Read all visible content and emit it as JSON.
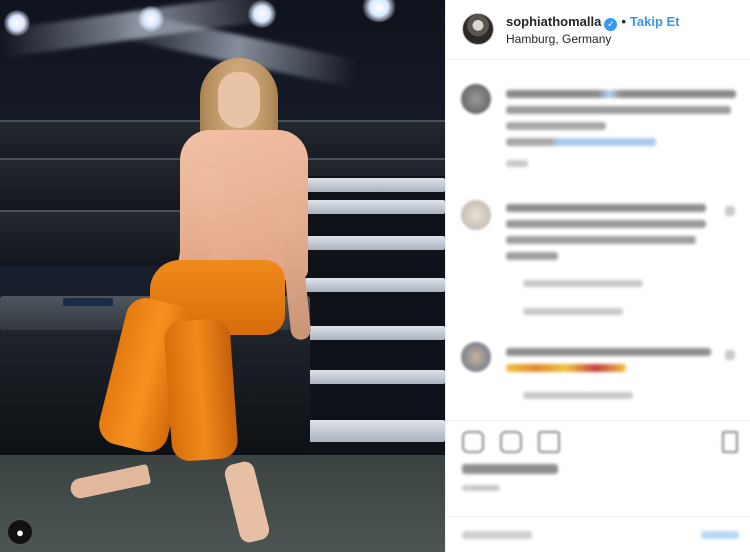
{
  "post": {
    "username": "sophiathomalla",
    "verified_icon": "verified-badge-icon",
    "separator": "•",
    "follow_label": "Takip Et",
    "location": "Hamburg, Germany"
  },
  "photo_overlay": {
    "profile_icon": "user-silhouette-icon"
  },
  "colors": {
    "accent": "#3897f0",
    "border": "#efefef",
    "text": "#262626"
  }
}
